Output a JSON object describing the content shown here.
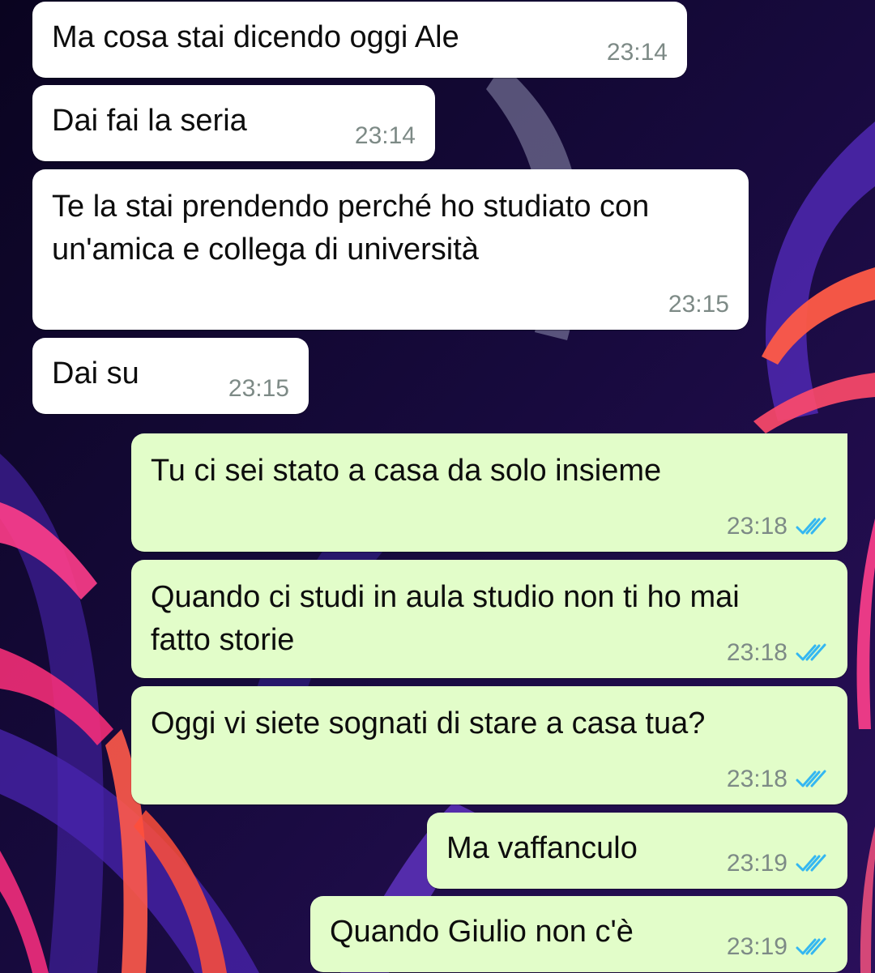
{
  "chat": {
    "messages": [
      {
        "direction": "incoming",
        "text": "Ma cosa stai dicendo oggi Ale",
        "time": "23:14"
      },
      {
        "direction": "incoming",
        "text": "Dai fai la seria",
        "time": "23:14"
      },
      {
        "direction": "incoming",
        "text": "Te la stai prendendo perché ho studiato con un'amica e collega di università",
        "time": "23:15"
      },
      {
        "direction": "incoming",
        "text": "Dai su",
        "time": "23:15"
      },
      {
        "direction": "outgoing",
        "text": "Tu ci sei stato a casa da solo insieme",
        "time": "23:18",
        "status": "read"
      },
      {
        "direction": "outgoing",
        "text": "Quando ci studi in aula studio non ti ho mai fatto storie",
        "time": "23:18",
        "status": "read"
      },
      {
        "direction": "outgoing",
        "text": "Oggi vi siete sognati di stare a casa tua?",
        "time": "23:18",
        "status": "read"
      },
      {
        "direction": "outgoing",
        "text": "Ma vaffanculo",
        "time": "23:19",
        "status": "read"
      },
      {
        "direction": "outgoing",
        "text": "Quando Giulio non c'è",
        "time": "23:19",
        "status": "read"
      }
    ]
  },
  "colors": {
    "incoming_bubble": "#ffffff",
    "outgoing_bubble": "#e2fdc9",
    "read_tick": "#34b7f1",
    "timestamp": "#7d8a86"
  },
  "icons": {
    "read_status": "double-check-icon"
  }
}
